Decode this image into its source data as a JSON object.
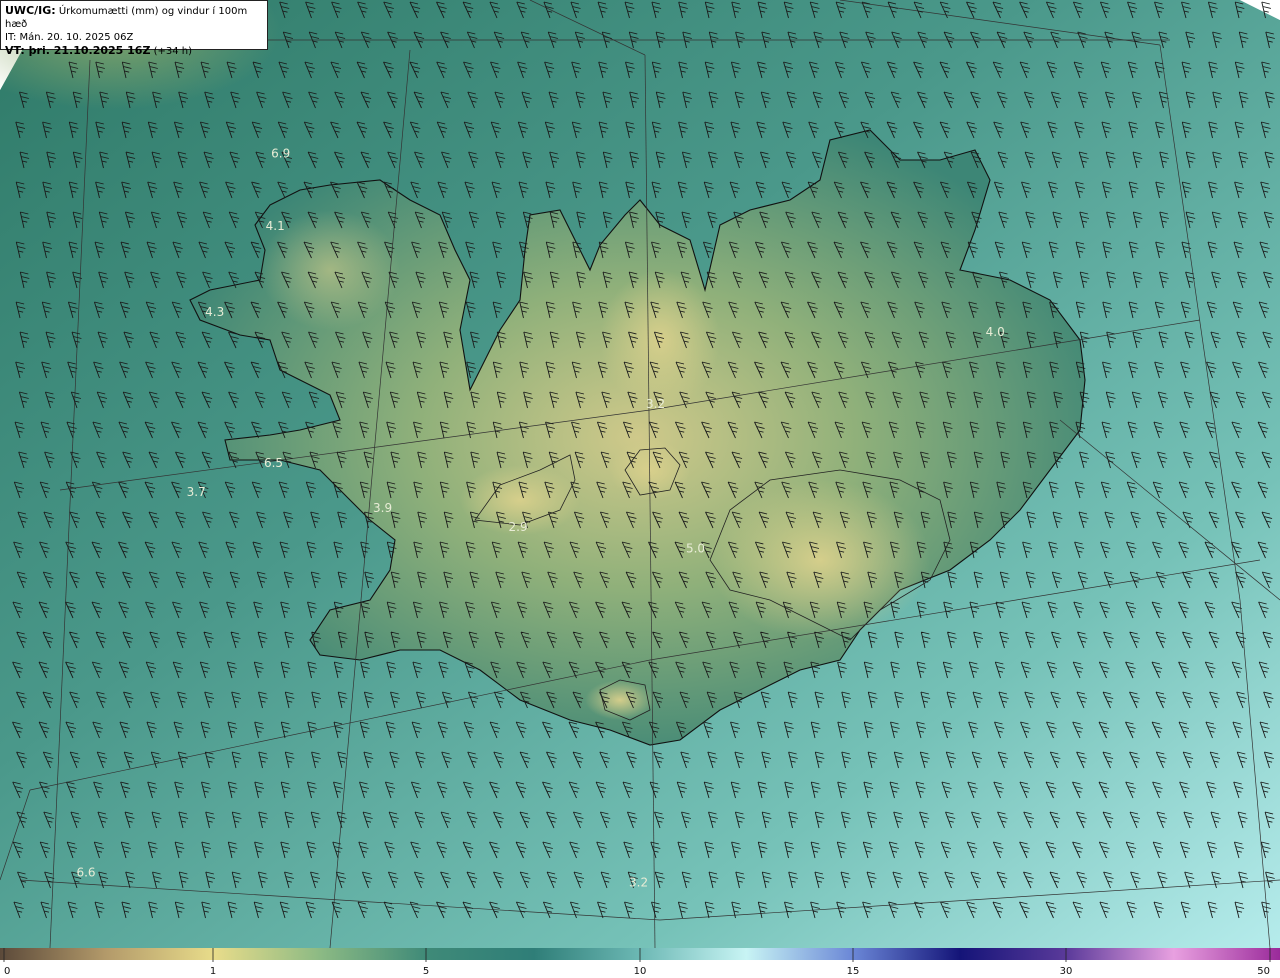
{
  "header": {
    "model_prefix": "UWC/IG:",
    "title": " Úrkomumætti (mm) og vindur í 100m hæð",
    "it_line": "IT: Mán. 20. 10. 2025 06Z",
    "vt_prefix": "VT: þri. 21.10.2025 16Z",
    "vt_suffix": " (+34 h)"
  },
  "map_labels": [
    {
      "text": "6.9",
      "lon": -22.8,
      "lat": 66.25
    },
    {
      "text": "4.1",
      "lon": -22.9,
      "lat": 65.98
    },
    {
      "text": "4.3",
      "lon": -23.6,
      "lat": 65.65
    },
    {
      "text": "6.5",
      "lon": -23.05,
      "lat": 65.1
    },
    {
      "text": "3.7",
      "lon": -23.9,
      "lat": 64.98
    },
    {
      "text": "3.9",
      "lon": -21.9,
      "lat": 64.95
    },
    {
      "text": "2.9",
      "lon": -20.45,
      "lat": 64.9
    },
    {
      "text": "5.0",
      "lon": -18.55,
      "lat": 64.85
    },
    {
      "text": "3.2",
      "lon": -18.9,
      "lat": 65.38
    },
    {
      "text": "4.0",
      "lon": -15.2,
      "lat": 65.7
    },
    {
      "text": "3.2",
      "lon": -19.35,
      "lat": 63.6
    },
    {
      "text": "6.6",
      "lon": -25.3,
      "lat": 63.55
    }
  ],
  "colorbar": {
    "ticks": [
      "0",
      "1",
      "5",
      "10",
      "15",
      "30",
      "50"
    ],
    "colors": [
      "#5c4a3a",
      "#b39a6a",
      "#e8dc8a",
      "#8cba84",
      "#3f8a78",
      "#2f7e78",
      "#6cb8b4",
      "#c8f4f4",
      "#6a86d6",
      "#141478",
      "#5a3a9a",
      "#e8a0e0",
      "#9a2a9a"
    ]
  },
  "legend": {
    "variable": "Úrkomumætti (mm)"
  }
}
